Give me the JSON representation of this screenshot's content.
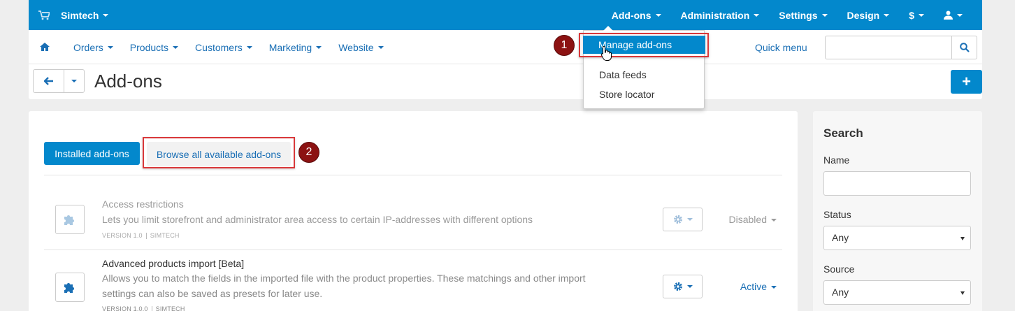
{
  "topbar": {
    "brand": "Simtech",
    "nav": [
      "Add-ons",
      "Administration",
      "Settings",
      "Design",
      "$"
    ]
  },
  "subbar": {
    "nav": [
      "Orders",
      "Products",
      "Customers",
      "Marketing",
      "Website"
    ],
    "quick_menu": "Quick menu",
    "search_placeholder": ""
  },
  "titlebar": {
    "title": "Add-ons"
  },
  "dropdown": {
    "items": [
      "Manage add-ons",
      "Data feeds",
      "Store locator"
    ]
  },
  "badges": [
    "1",
    "2"
  ],
  "tabs": {
    "installed": "Installed add-ons",
    "browse": "Browse all available add-ons"
  },
  "addons": [
    {
      "name": "Access restrictions",
      "description": "Lets you limit storefront and administrator area access to certain IP-addresses with different options",
      "version": "VERSION 1.0",
      "vendor": "SIMTECH",
      "status": "Disabled"
    },
    {
      "name": "Advanced products import [Beta]",
      "description_line1": "Allows you to match the fields in the imported file with the product properties. These matchings and other import",
      "description_line2": "settings can also be saved as presets for later use.",
      "version": "VERSION 1.0.0",
      "vendor": "SIMTECH",
      "status": "Active"
    }
  ],
  "sidebar": {
    "title": "Search",
    "name_label": "Name",
    "status_label": "Status",
    "status_value": "Any",
    "source_label": "Source",
    "source_value": "Any"
  },
  "colors": {
    "brand_blue": "#0388cc",
    "link_blue": "#1a6fb5",
    "highlight_red": "#d9383a",
    "badge_red": "#8c1212"
  }
}
